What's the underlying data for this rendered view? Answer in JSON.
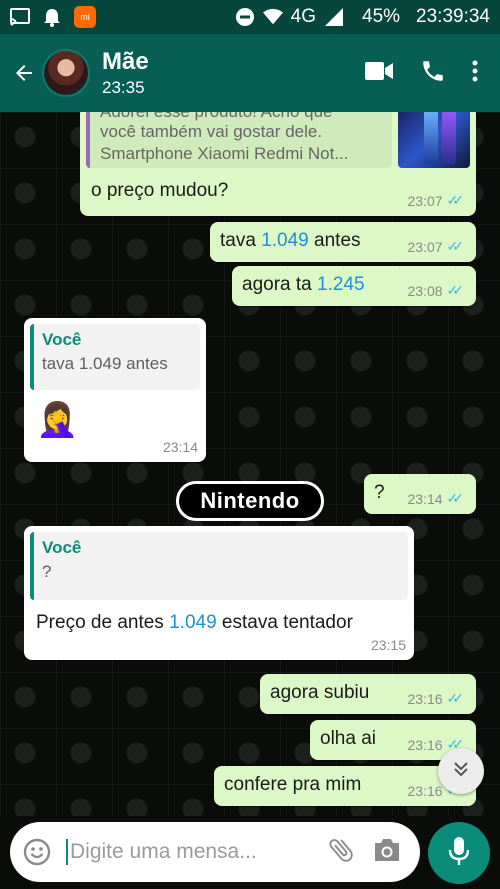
{
  "status_bar": {
    "battery": "45%",
    "time": "23:39:34",
    "network": "4G",
    "mi_badge": "mi",
    "icons": [
      "cast-icon",
      "bell-icon",
      "mi-app-icon",
      "dnd-icon",
      "wifi-icon",
      "signal-icon"
    ]
  },
  "header": {
    "contact_name": "Mãe",
    "last_seen": "23:35",
    "icons": [
      "back-arrow-icon",
      "video-call-icon",
      "phone-icon",
      "more-vert-icon"
    ]
  },
  "messages": {
    "m1": {
      "preview_text_1": "Adorei esse produto! Acho que",
      "preview_text_2": "você também vai gostar dele.",
      "preview_text_3": "Smartphone Xiaomi Redmi Not...",
      "text": "o preço mudou?",
      "time": "23:07"
    },
    "m2": {
      "pre": "tava ",
      "num": "1.049",
      "post": " antes",
      "time": "23:07"
    },
    "m3": {
      "pre": "agora ta ",
      "num": "1.245",
      "time": "23:08"
    },
    "m4": {
      "quote_name": "Você",
      "quote_text": "tava 1.049 antes",
      "emoji": "🤦‍♀️",
      "time": "23:14"
    },
    "m5": {
      "text": "?",
      "time": "23:14"
    },
    "sticker": {
      "text": "Nintendo"
    },
    "m6": {
      "quote_name": "Você",
      "quote_text": "?",
      "pre": "Preço de antes ",
      "num": "1.049",
      "post": " estava tentador",
      "time": "23:15"
    },
    "m7": {
      "text": "agora subiu",
      "time": "23:16"
    },
    "m8": {
      "text": "olha ai",
      "time": "23:16"
    },
    "m9": {
      "text": "confere pra mim",
      "time": "23:16"
    }
  },
  "input": {
    "placeholder": "Digite uma mensa..."
  },
  "colors": {
    "header": "#075e54",
    "status": "#06463c",
    "outgoing": "#dcf8c6",
    "incoming": "#ffffff",
    "accent": "#0b8b7a",
    "tick_read": "#34b7f1"
  }
}
